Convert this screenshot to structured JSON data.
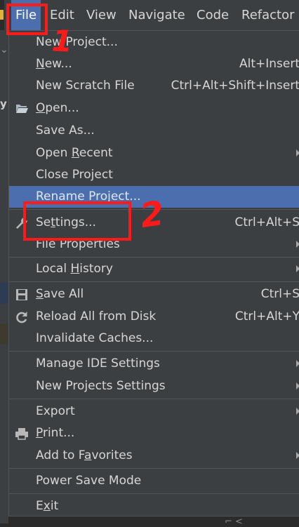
{
  "menubar": {
    "items": [
      {
        "label": "File",
        "active": true
      },
      {
        "label": "Edit"
      },
      {
        "label": "View"
      },
      {
        "label": "Navigate"
      },
      {
        "label": "Code"
      },
      {
        "label": "Refactor"
      }
    ]
  },
  "file_menu": {
    "items": [
      {
        "label_pre": "",
        "mnemonic": "",
        "label_post": "New Project...",
        "shortcut": "",
        "submenu": false
      },
      {
        "label_pre": "",
        "mnemonic": "N",
        "label_post": "ew...",
        "shortcut": "Alt+Insert",
        "submenu": false
      },
      {
        "label_pre": "New Scratch File",
        "mnemonic": "",
        "label_post": "",
        "shortcut": "Ctrl+Alt+Shift+Insert",
        "submenu": false
      },
      {
        "label_pre": "",
        "mnemonic": "O",
        "label_post": "pen...",
        "shortcut": "",
        "submenu": false,
        "icon": "folder-open-icon"
      },
      {
        "label_pre": "Save As...",
        "mnemonic": "",
        "label_post": "",
        "shortcut": "",
        "submenu": false
      },
      {
        "label_pre": "Open ",
        "mnemonic": "R",
        "label_post": "ecent",
        "shortcut": "",
        "submenu": true
      },
      {
        "label_pre": "Close Project",
        "mnemonic": "",
        "label_post": "",
        "shortcut": "",
        "submenu": false
      },
      {
        "label_pre": "Rename Project...",
        "mnemonic": "",
        "label_post": "",
        "shortcut": "",
        "submenu": false,
        "highlighted": true
      },
      {
        "label_pre": "Se",
        "mnemonic": "t",
        "label_post": "tings...",
        "shortcut": "Ctrl+Alt+S",
        "submenu": false,
        "icon": "wrench-icon"
      },
      {
        "label_pre": "File Properties",
        "mnemonic": "",
        "label_post": "",
        "shortcut": "",
        "submenu": true
      },
      {
        "label_pre": "Local ",
        "mnemonic": "H",
        "label_post": "istory",
        "shortcut": "",
        "submenu": true
      },
      {
        "label_pre": "",
        "mnemonic": "S",
        "label_post": "ave All",
        "shortcut": "Ctrl+S",
        "submenu": false,
        "icon": "save-icon"
      },
      {
        "label_pre": "Reload All from Disk",
        "mnemonic": "",
        "label_post": "",
        "shortcut": "Ctrl+Alt+Y",
        "submenu": false,
        "icon": "reload-icon"
      },
      {
        "label_pre": "Invalidate Caches...",
        "mnemonic": "",
        "label_post": "",
        "shortcut": "",
        "submenu": false
      },
      {
        "label_pre": "Manage IDE Settings",
        "mnemonic": "",
        "label_post": "",
        "shortcut": "",
        "submenu": true
      },
      {
        "label_pre": "New Projects Settings",
        "mnemonic": "",
        "label_post": "",
        "shortcut": "",
        "submenu": true
      },
      {
        "label_pre": "Export",
        "mnemonic": "",
        "label_post": "",
        "shortcut": "",
        "submenu": true
      },
      {
        "label_pre": "",
        "mnemonic": "P",
        "label_post": "rint...",
        "shortcut": "",
        "submenu": false,
        "icon": "printer-icon"
      },
      {
        "label_pre": "Add to F",
        "mnemonic": "a",
        "label_post": "vorites",
        "shortcut": "",
        "submenu": true
      },
      {
        "label_pre": "Power Save Mode",
        "mnemonic": "",
        "label_post": "",
        "shortcut": "",
        "submenu": false
      },
      {
        "label_pre": "E",
        "mnemonic": "x",
        "label_post": "it",
        "shortcut": "",
        "submenu": false
      }
    ]
  },
  "annotations": {
    "step1": "1",
    "step2": "2",
    "color": "#ff1a1a"
  },
  "colors": {
    "menu_bg": "#3c3f41",
    "highlight": "#4b6eaf",
    "text": "#d6d6d6",
    "separator": "#515658"
  }
}
